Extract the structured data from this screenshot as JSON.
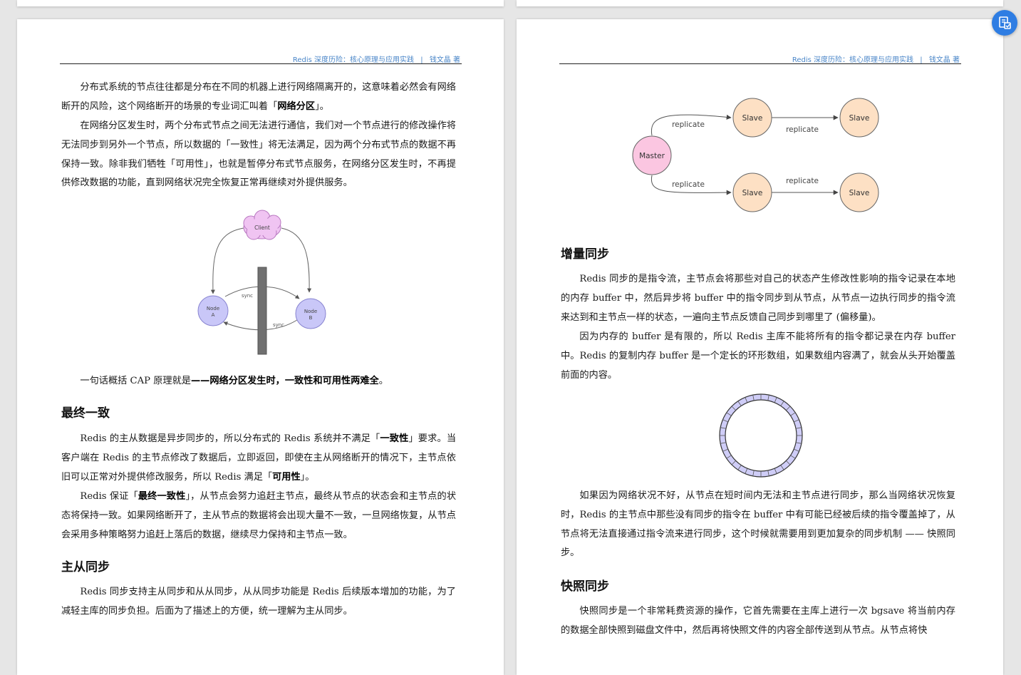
{
  "header": {
    "book_title": "Redis 深度历险：核心原理与应用实践",
    "separator": "|",
    "author": "钱文晶 著"
  },
  "left_page": {
    "p1_a": "分布式系统的节点往往都是分布在不同的机器上进行网络隔离开的，这意味着必然会有网络断开的风险，这个网络断开的场景的专业词汇叫着「",
    "p1_bold": "网络分区",
    "p1_b": "」。",
    "p2": "在网络分区发生时，两个分布式节点之间无法进行通信，我们对一个节点进行的修改操作将无法同步到另外一个节点，所以数据的「一致性」将无法满足，因为两个分布式节点的数据不再保持一致。除非我们牺牲「可用性」，也就是暂停分布式节点服务，在网络分区发生时，不再提供修改数据的功能，直到网络状况完全恢复正常再继续对外提供服务。",
    "cap_diagram": {
      "client": "Client",
      "node_a_line1": "Node",
      "node_a_line2": "A",
      "node_b_line1": "Node",
      "node_b_line2": "B",
      "sync_top": "sync",
      "sync_bottom": "sync"
    },
    "p3_a": "一句话概括 CAP 原理就是",
    "p3_bold": "——网络分区发生时，一致性和可用性两难全",
    "p3_b": "。",
    "h_eventual": "最终一致",
    "p4_a": "Redis 的主从数据是异步同步的，所以分布式的 Redis 系统并不满足「",
    "p4_bold1": "一致性",
    "p4_b": "」要求。当客户端在 Redis 的主节点修改了数据后，立即返回，即使在主从网络断开的情况下，主节点依旧可以正常对外提供修改服务，所以 Redis 满足「",
    "p4_bold2": "可用性",
    "p4_c": "」。",
    "p5_a": "Redis 保证「",
    "p5_bold": "最终一致性",
    "p5_b": "」，从节点会努力追赶主节点，最终从节点的状态会和主节点的状态将保持一致。如果网络断开了，主从节点的数据将会出现大量不一致，一旦网络恢复，从节点会采用多种策略努力追赶上落后的数据，继续尽力保持和主节点一致。",
    "h_master_slave": "主从同步",
    "p6": "Redis 同步支持主从同步和从从同步，从从同步功能是 Redis 后续版本增加的功能，为了减轻主库的同步负担。后面为了描述上的方便，统一理解为主从同步。"
  },
  "right_page": {
    "replication_diagram": {
      "master": "Master",
      "slave": "Slave",
      "replicate": "replicate"
    },
    "h_incremental": "增量同步",
    "p1": "Redis 同步的是指令流，主节点会将那些对自己的状态产生修改性影响的指令记录在本地的内存 buffer 中，然后异步将 buffer 中的指令同步到从节点，从节点一边执行同步的指令流来达到和主节点一样的状态，一遍向主节点反馈自己同步到哪里了 (偏移量)。",
    "p2": "因为内存的 buffer 是有限的，所以 Redis 主库不能将所有的指令都记录在内存 buffer 中。Redis 的复制内存 buffer 是一个定长的环形数组，如果数组内容满了，就会从头开始覆盖前面的内容。",
    "p3": "如果因为网络状况不好，从节点在短时间内无法和主节点进行同步，那么当网络状况恢复时，Redis 的主节点中那些没有同步的指令在 buffer 中有可能已经被后续的指令覆盖掉了，从节点将无法直接通过指令流来进行同步，这个时候就需要用到更加复杂的同步机制 —— 快照同步。",
    "h_snapshot": "快照同步",
    "p4": "快照同步是一个非常耗费资源的操作，它首先需要在主库上进行一次 bgsave 将当前内存的数据全部快照到磁盘文件中，然后再将快照文件的内容全部传送到从节点。从节点将快"
  },
  "ring_buffer": {
    "segments": 32
  },
  "colors": {
    "link_blue": "#4a86c8",
    "client_fill": "#f0c4f2",
    "node_fill": "#c9c7f8",
    "master_fill": "#fbc6e1",
    "slave_fill": "#fde0c4",
    "ring_fill": "#cfcdf7",
    "fab_blue": "#2e7de3"
  }
}
